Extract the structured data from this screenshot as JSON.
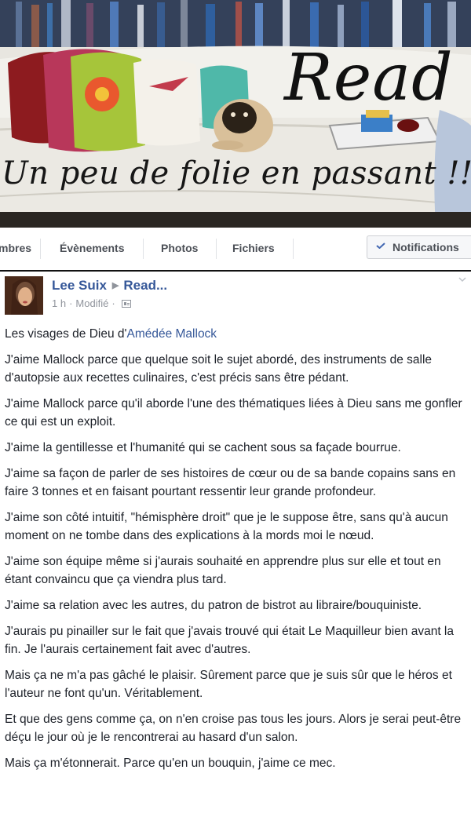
{
  "cover": {
    "title": "Read",
    "tagline": "Un peu de folie en passant !!!"
  },
  "nav": {
    "items": [
      "mbres",
      "Évènements",
      "Photos",
      "Fichiers"
    ],
    "notifications_label": "Notifications"
  },
  "post": {
    "author": "Lee Suix",
    "group": "Read...",
    "time": "1 h",
    "edited": "Modifié",
    "intro_text": "Les visages de Dieu d'",
    "intro_link": "Amédée Mallock",
    "paragraphs": [
      "J'aime Mallock parce que quelque soit le sujet abordé, des instruments de salle d'autopsie aux recettes culinaires, c'est précis sans être pédant.",
      "J'aime Mallock parce qu'il aborde l'une des thématiques liées à Dieu sans me gonfler ce qui est un exploit.",
      "J'aime la gentillesse et l'humanité qui se cachent sous sa façade bourrue.",
      "J'aime sa façon de parler de ses histoires de cœur ou de sa bande copains sans en faire 3 tonnes et en faisant pourtant ressentir leur grande profondeur.",
      "J'aime son côté intuitif, \"hémisphère droit\" que je le suppose être, sans qu'à aucun moment on ne tombe dans des explications à la mords moi le nœud.",
      "J'aime son équipe même si j'aurais souhaité en apprendre plus sur elle et tout en étant convaincu que ça viendra plus tard.",
      "J'aime sa relation avec les autres, du patron de bistrot au libraire/bouquiniste.",
      "J'aurais pu pinailler sur le fait que j'avais trouvé qui était Le Maquilleur bien avant la fin. Je l'aurais certainement fait avec d'autres.",
      "Mais ça ne m'a pas gâché le plaisir. Sûrement parce que je suis sûr que le héros et l'auteur ne font qu'un. Véritablement.",
      "Et que des gens comme ça, on n'en croise pas tous les jours. Alors je serai peut-être déçu le jour où je le rencontrerai au hasard d'un salon.",
      "Mais ça m'étonnerait. Parce qu'en un bouquin, j'aime ce mec."
    ]
  },
  "colors": {
    "link": "#365899",
    "text": "#1d2129",
    "meta": "#90949c"
  },
  "icons": [
    "check-icon",
    "chevron-down-icon",
    "arrow-right-icon",
    "audience-icon"
  ]
}
